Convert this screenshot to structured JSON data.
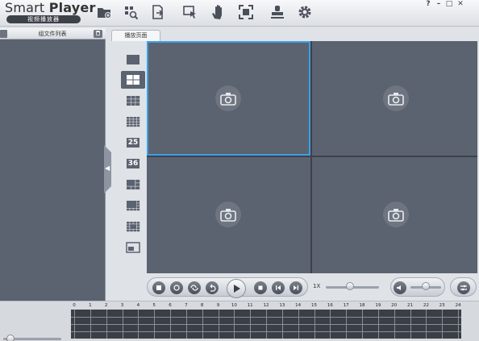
{
  "app": {
    "title_light": "Smart ",
    "title_bold": "Player",
    "subtitle": "视频播放器"
  },
  "toolbar": {
    "buttons": [
      {
        "name": "open-folder",
        "icon": "folder-plus-icon"
      },
      {
        "name": "search-files",
        "icon": "file-search-icon"
      },
      {
        "name": "export-file",
        "icon": "file-export-icon"
      },
      {
        "name": "select-region",
        "icon": "cursor-select-icon"
      },
      {
        "name": "pan-hand",
        "icon": "hand-icon"
      },
      {
        "name": "fullscreen",
        "icon": "fullscreen-icon"
      },
      {
        "name": "stamp",
        "icon": "stamp-icon"
      },
      {
        "name": "settings",
        "icon": "gear-icon"
      }
    ]
  },
  "window": {
    "help": "?",
    "minimize": "–",
    "maximize": "□",
    "close": "✕"
  },
  "left_panel": {
    "title": "组文件列表"
  },
  "tabs": [
    {
      "label": "播放页面"
    }
  ],
  "layouts": [
    {
      "label": "1",
      "active": false
    },
    {
      "label": "4",
      "active": true
    },
    {
      "label": "9",
      "active": false
    },
    {
      "label": "16",
      "active": false
    },
    {
      "label": "25",
      "active": false
    },
    {
      "label": "36",
      "active": false
    },
    {
      "label": "6",
      "active": false
    },
    {
      "label": "8",
      "active": false
    },
    {
      "label": "13",
      "active": false
    },
    {
      "label": "PiP",
      "active": false
    }
  ],
  "controls": {
    "speed": "1X",
    "volume_level": 0.5,
    "speed_level": 0.45
  },
  "timeline": {
    "hours": [
      "0",
      "1",
      "2",
      "3",
      "4",
      "5",
      "6",
      "7",
      "8",
      "9",
      "10",
      "11",
      "12",
      "13",
      "14",
      "15",
      "16",
      "17",
      "18",
      "19",
      "20",
      "21",
      "22",
      "23",
      "24"
    ]
  },
  "colors": {
    "accent_selection": "#3aa0e6",
    "video_bg": "#5b6270"
  }
}
